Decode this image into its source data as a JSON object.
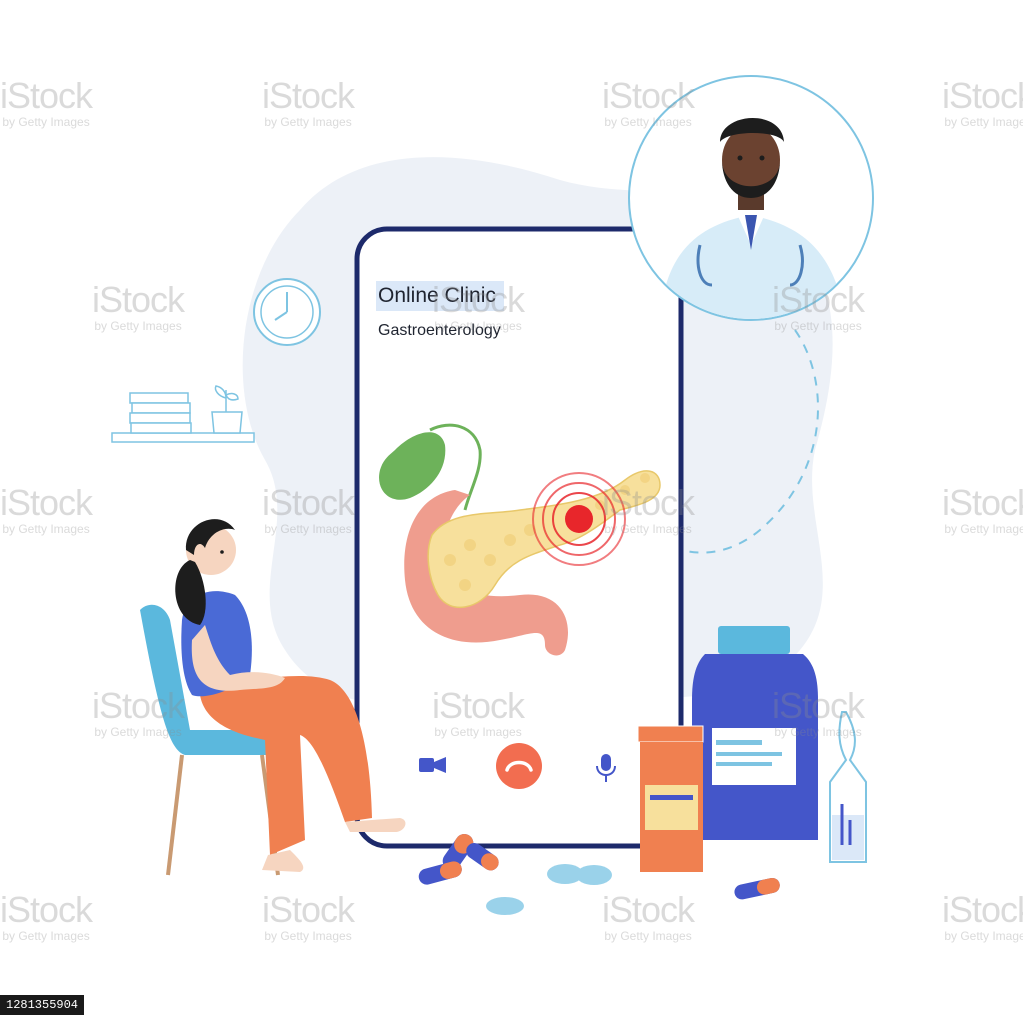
{
  "screen": {
    "title": "Online Clinic",
    "subtitle": "Gastroenterology"
  },
  "watermark": {
    "brand": "iStock",
    "credit": "by Getty Images"
  },
  "stock_id": "1281355904",
  "colors": {
    "phone_frame": "#1d2a6b",
    "highlight": "#dbe8f8",
    "pain_red": "#e8262b",
    "pancreas": "#f7e09c",
    "stomach": "#ef9d8e",
    "gallbladder": "#6db25a",
    "call_button": "#f26d50",
    "chair": "#5bb8dd",
    "shirt": "#4a6ad6",
    "pants": "#f08050",
    "jar": "#4456c9"
  },
  "icons": [
    "video-camera-icon",
    "hang-up-icon",
    "microphone-icon",
    "clock-icon"
  ]
}
